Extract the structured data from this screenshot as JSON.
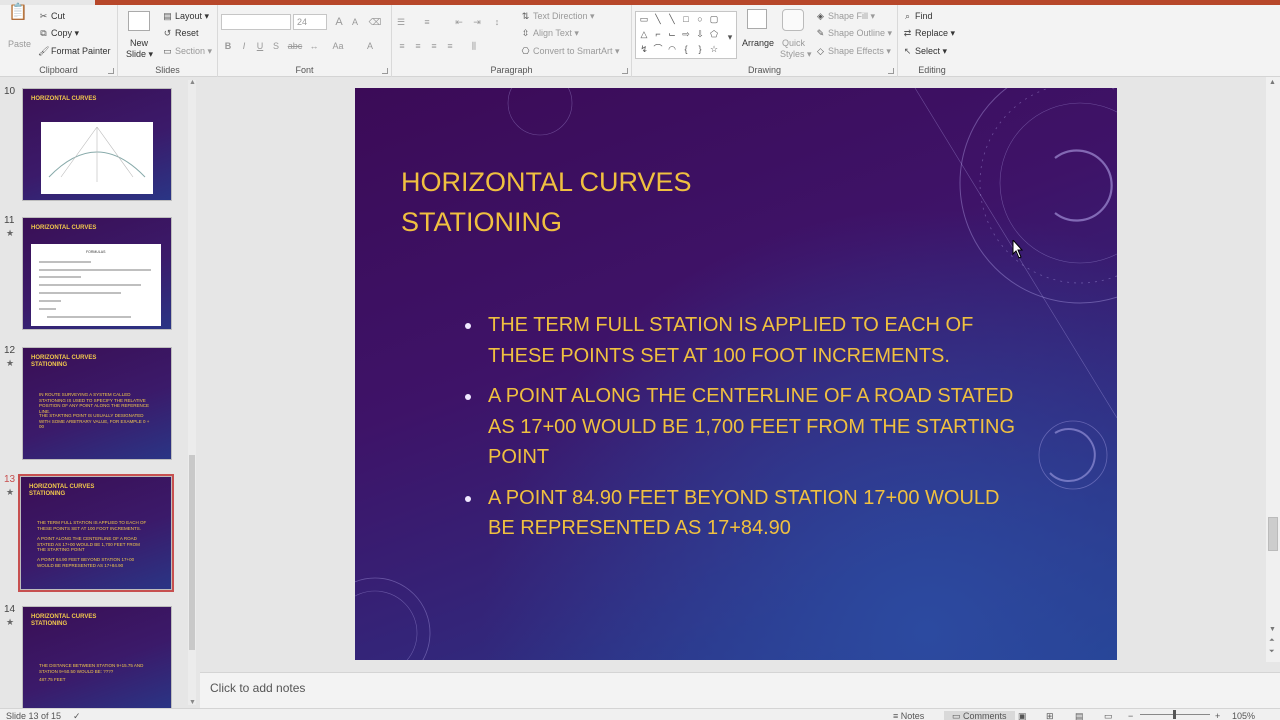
{
  "ribbon": {
    "clipboard": {
      "paste": "Paste",
      "cut": "Cut",
      "copy": "Copy",
      "format_painter": "Format Painter",
      "label": "Clipboard"
    },
    "slides": {
      "new_slide": "New",
      "new_slide2": "Slide",
      "layout": "Layout",
      "reset": "Reset",
      "section": "Section",
      "label": "Slides"
    },
    "font": {
      "font_name": "",
      "font_size": "24",
      "bold": "B",
      "italic": "I",
      "underline": "U",
      "strike": "S",
      "spacing": "abc",
      "aa": "Aa",
      "color": "A",
      "label": "Font"
    },
    "paragraph": {
      "text_direction": "Text Direction",
      "align_text": "Align Text",
      "convert_smartart": "Convert to SmartArt",
      "label": "Paragraph"
    },
    "drawing": {
      "arrange": "Arrange",
      "quick_styles": "Quick",
      "quick_styles2": "Styles",
      "shape_fill": "Shape Fill",
      "shape_outline": "Shape Outline",
      "shape_effects": "Shape Effects",
      "label": "Drawing"
    },
    "editing": {
      "find": "Find",
      "replace": "Replace",
      "select": "Select",
      "label": "Editing"
    }
  },
  "thumbnails": [
    {
      "num": "10",
      "star": "",
      "title": "HORIZONTAL CURVES"
    },
    {
      "num": "11",
      "star": "★",
      "title": "HORIZONTAL CURVES",
      "formula_title": "FORMULAS"
    },
    {
      "num": "12",
      "star": "★",
      "title": "HORIZONTAL CURVES STATIONING",
      "b1": "IN ROUTE SURVEYING A SYSTEM CALLED STATIONING IS USED TO SPECIFY THE RELATIVE POSITION OF ANY POINT ALONG THE REFERENCE LINE.",
      "b2": "THE STARTING POINT IS USUALLY DESIGNATED WITH SOME ARBITRARY VALUE, FOR EXAMPLE 0 + 00"
    },
    {
      "num": "13",
      "star": "★",
      "title": "HORIZONTAL CURVES STATIONING",
      "b1": "THE TERM FULL STATION IS APPLIED TO EACH OF THESE POINTS SET AT 100 FOOT INCREMENTS.",
      "b2": "A POINT ALONG THE CENTERLINE OF A ROAD STATED AS 17+00 WOULD BE 1,700 FEET FROM THE STARTING POINT",
      "b3": "A POINT 84.90 FEET BEYOND STATION 17+00 WOULD BE REPRESENTED AS 17+84.90"
    },
    {
      "num": "14",
      "star": "★",
      "title": "HORIZONTAL CURVES STATIONING",
      "b1": "THE DISTANCE BETWEEN STATION 9+15.75 AND STATION 9+50.50 WOULD BE: ????",
      "b2": "487.75 FEET"
    }
  ],
  "slide": {
    "title_line1": "HORIZONTAL CURVES",
    "title_line2": "STATIONING",
    "bullets": [
      "THE TERM FULL STATION IS APPLIED TO EACH OF THESE POINTS SET AT 100 FOOT INCREMENTS.",
      "A POINT ALONG THE CENTERLINE OF A ROAD STATED AS 17+00 WOULD BE 1,700 FEET FROM THE STARTING POINT",
      "A POINT 84.90 FEET BEYOND STATION 17+00 WOULD BE REPRESENTED AS 17+84.90"
    ]
  },
  "notes": {
    "placeholder": "Click to add notes"
  },
  "status": {
    "slide_info": "Slide 13 of 15",
    "notes": "Notes",
    "comments": "Comments",
    "zoom": "105%"
  },
  "colors": {
    "accent": "#b7472a",
    "title_text": "#f0c040",
    "selection": "#c75050"
  }
}
